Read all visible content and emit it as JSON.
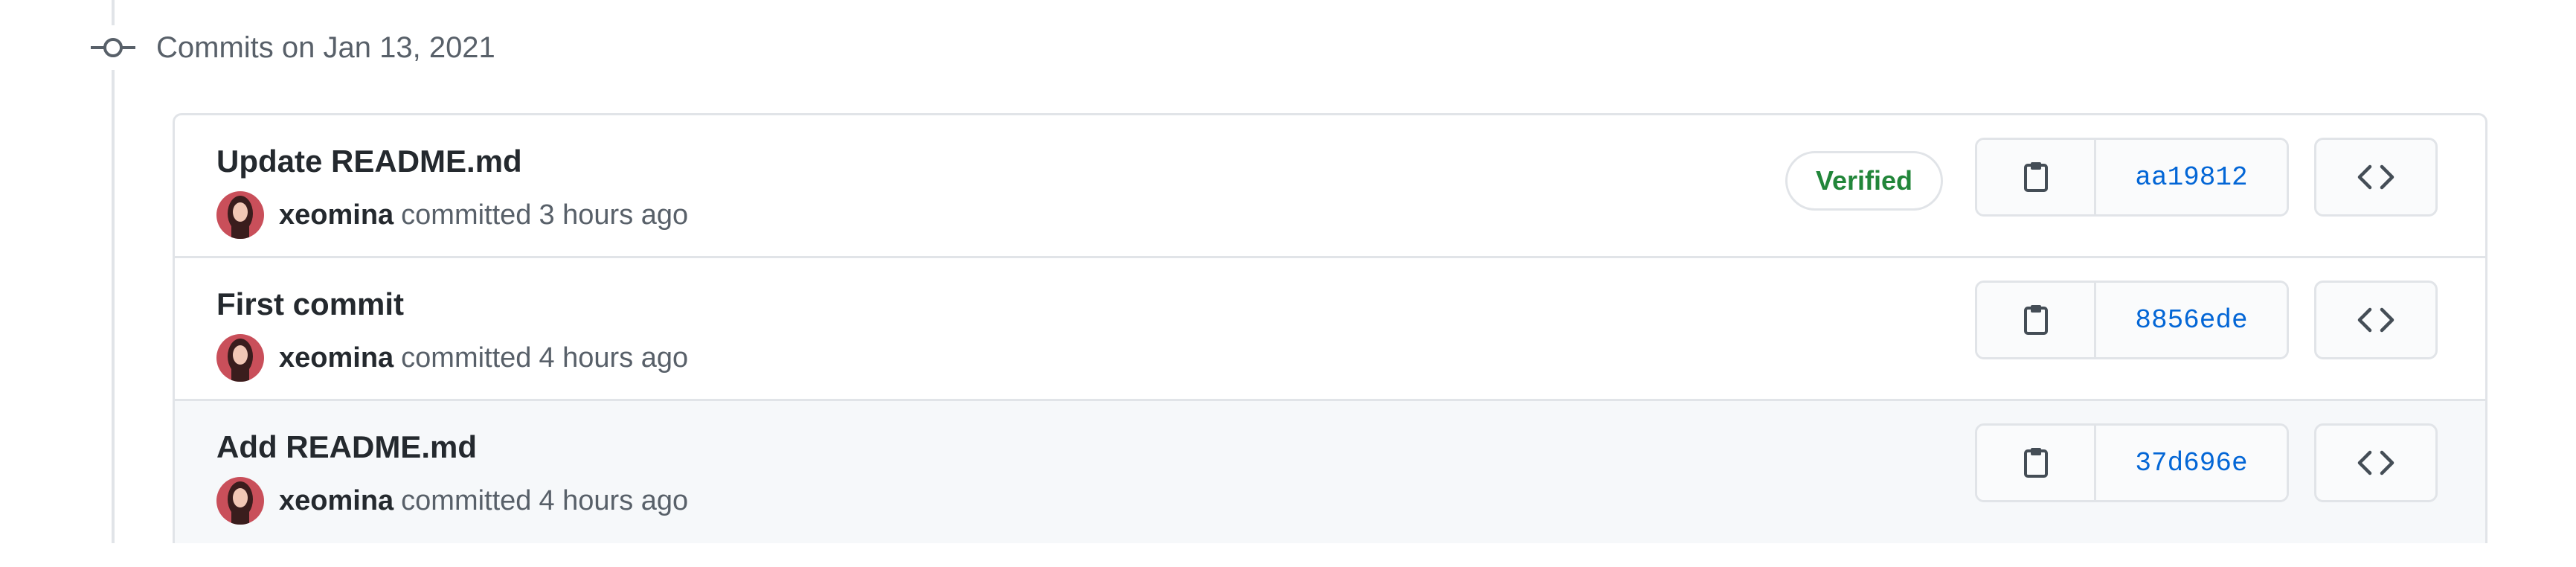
{
  "group": {
    "title": "Commits on Jan 13, 2021"
  },
  "commits": [
    {
      "title": "Update README.md",
      "author": "xeomina",
      "action": "committed",
      "time": "3 hours ago",
      "verified": "Verified",
      "sha": "aa19812"
    },
    {
      "title": "First commit",
      "author": "xeomina",
      "action": "committed",
      "time": "4 hours ago",
      "sha": "8856ede"
    },
    {
      "title": "Add README.md",
      "author": "xeomina",
      "action": "committed",
      "time": "4 hours ago",
      "sha": "37d696e"
    }
  ],
  "icons": {
    "timeline": "git-commit-icon",
    "copy": "clippy-icon",
    "browse": "code-icon"
  },
  "colors": {
    "verified": "#22863a",
    "sha_link": "#0366d6",
    "border": "#e1e4e8",
    "muted_text": "#586069",
    "hover_row": "#f6f8fa"
  }
}
